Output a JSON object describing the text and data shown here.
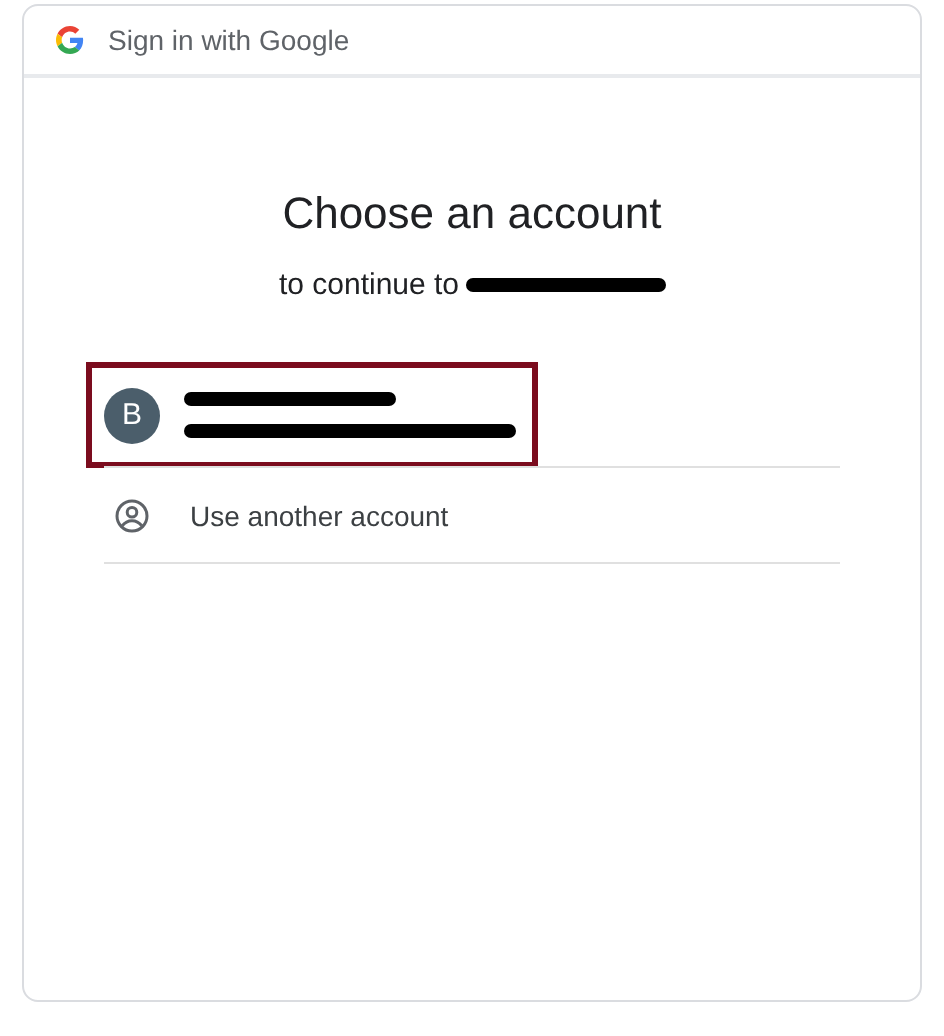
{
  "header": {
    "title": "Sign in with Google"
  },
  "heading": "Choose an account",
  "subtitle": {
    "text": "to continue to",
    "site_redacted": true
  },
  "accounts": [
    {
      "kind": "account",
      "avatar_letter": "B",
      "name_redacted": true,
      "email_redacted": true,
      "highlighted": true
    },
    {
      "kind": "other",
      "label": "Use another account",
      "highlighted": false
    }
  ]
}
